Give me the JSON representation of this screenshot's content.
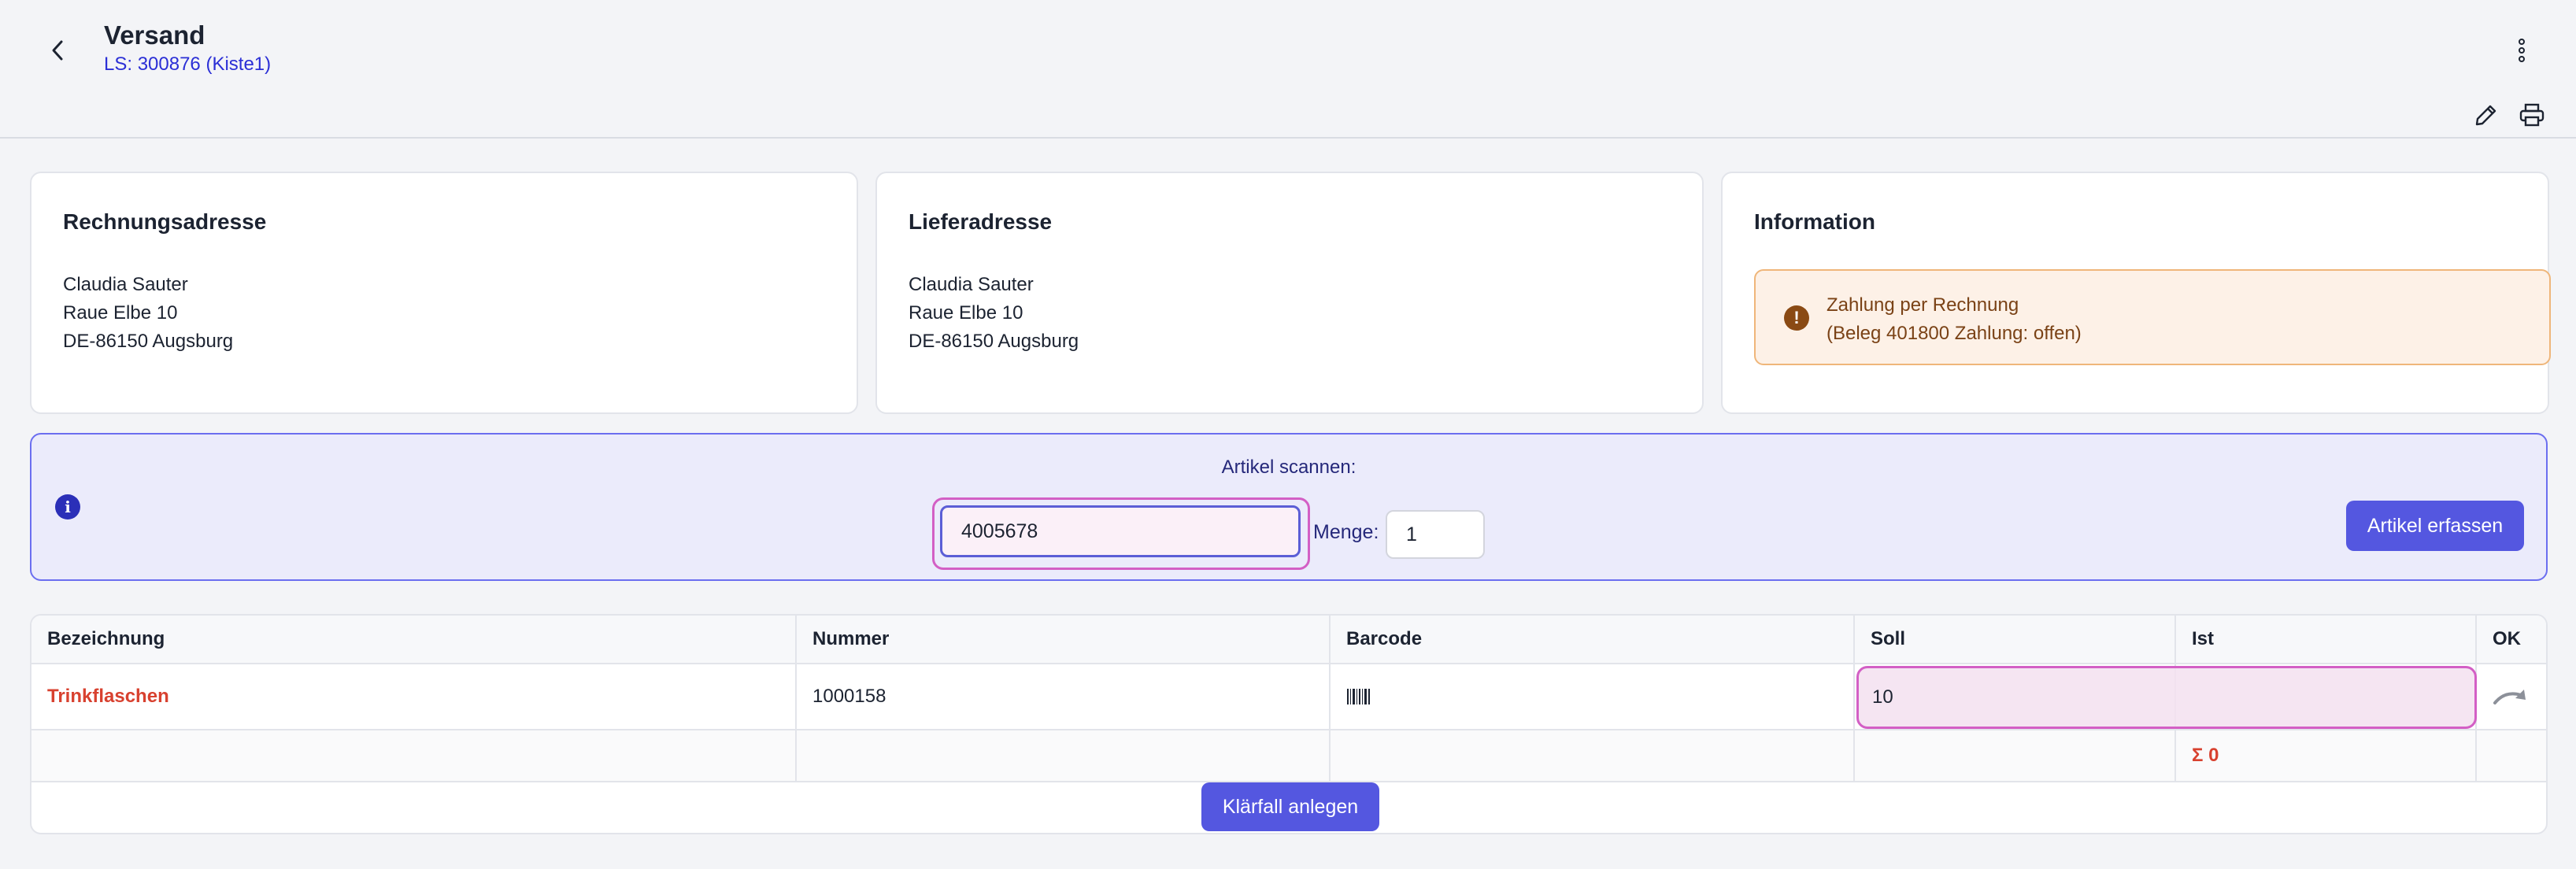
{
  "header": {
    "title": "Versand",
    "subtitle": "LS: 300876 (Kiste1)",
    "back_icon": "chevron-left-icon",
    "menu_icon": "kebab-icon",
    "edit_icon": "pencil-icon",
    "print_icon": "printer-icon"
  },
  "cards": {
    "billing": {
      "title": "Rechnungsadresse",
      "name": "Claudia Sauter",
      "street": "Raue Elbe 10",
      "city": "DE-86150 Augsburg"
    },
    "shipping": {
      "title": "Lieferadresse",
      "name": "Claudia Sauter",
      "street": "Raue Elbe 10",
      "city": "DE-86150 Augsburg"
    },
    "info": {
      "title": "Information",
      "alert_line1": "Zahlung per Rechnung",
      "alert_line2": "(Beleg 401800 Zahlung: offen)",
      "alert_icon": "!"
    }
  },
  "scan": {
    "info_icon": "i",
    "label": "Artikel scannen:",
    "barcode_value": "4005678",
    "menge_label": "Menge:",
    "menge_value": "1",
    "submit_label": "Artikel erfassen"
  },
  "table": {
    "columns": [
      "Bezeichnung",
      "Nummer",
      "Barcode",
      "Soll",
      "Ist",
      "OK"
    ],
    "rows": [
      {
        "bezeichnung": "Trinkflaschen",
        "nummer": "1000158",
        "barcode_icon": "barcode-icon",
        "soll": "10",
        "ist": "",
        "ok_icon": "redo-arrow-icon"
      }
    ],
    "footer": {
      "ist_sum": "Σ 0"
    }
  },
  "actions": {
    "klaerfall_label": "Klärfall anlegen"
  },
  "colors": {
    "accent": "#5457e0",
    "title_link": "#2b2fd6",
    "item_red": "#d8412f",
    "alert_bg": "#fdf1e7",
    "scan_bg": "#ebebfb",
    "highlight": "#d35fc5"
  }
}
